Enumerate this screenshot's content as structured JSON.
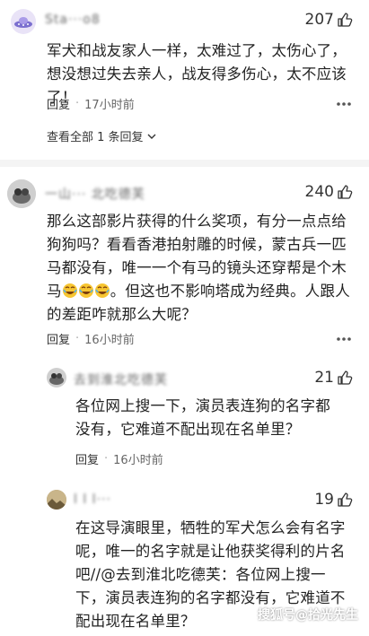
{
  "comments": [
    {
      "username": "Sta···o8",
      "likes": "207",
      "text": "军犬和战友家人一样，太难过了，太伤心了，想没想过失去亲人，战友得多伤心，太不应该了！",
      "reply_label": "回复",
      "time": "17小时前",
      "view_all": "查看全部 1 条回复"
    },
    {
      "username": "一山··· 北吃德芙",
      "likes": "240",
      "text_part1": "那么这部影片获得的什么奖项，有分一点点给狗狗吗？看看香港拍射雕的时候，蒙古兵一匹马都没有，唯一一个有马的镜头还穿帮是个木马",
      "text_part2": "。但这也不影响塔成为经典。人跟人的差距咋就那么大呢？",
      "reply_label": "回复",
      "time": "16小时前"
    },
    {
      "username": "去到淮北吃德芙",
      "likes": "21",
      "text": "各位网上搜一下，演员表连狗的名字都没有，它难道不配出现在名单里？",
      "reply_label": "回复",
      "time": "16小时前"
    },
    {
      "username": "l l l···",
      "likes": "19",
      "text": "在这导演眼里，牺牲的军犬怎么会有名字呢，唯一的名字就是让他获奖得利的片名吧//@去到淮北吃德芙：各位网上搜一下，演员表连狗的名字都没有，它难道不配出现在名单里？"
    }
  ],
  "watermark": "搜狐号@拾光先生",
  "colors": {
    "text": "#222222",
    "meta": "#666666",
    "divider": "#f4f4f4",
    "emoji": "#f7c531"
  }
}
